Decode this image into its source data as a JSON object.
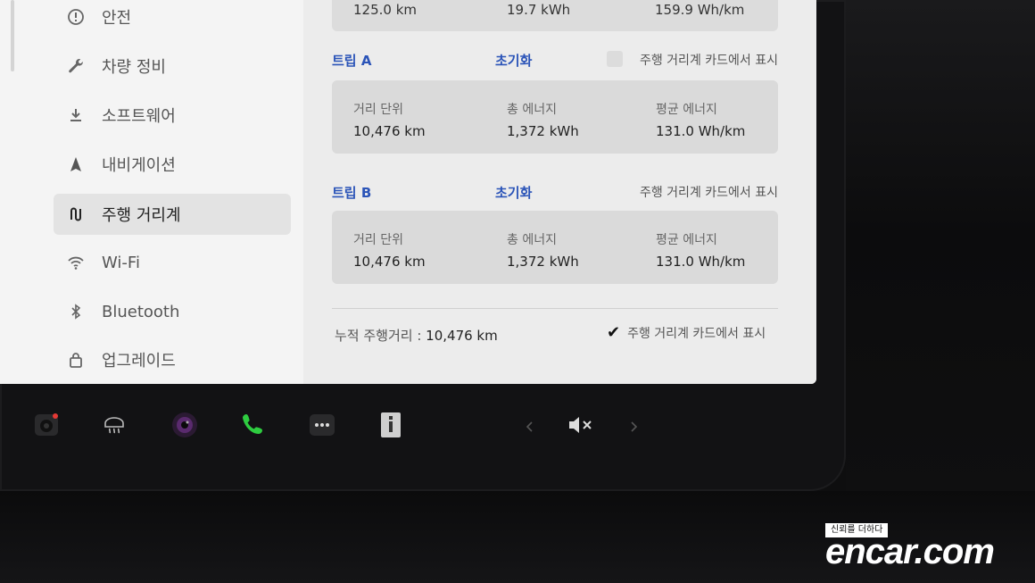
{
  "sidebar": {
    "items": [
      {
        "label": "안전",
        "icon": "shield-alert-icon"
      },
      {
        "label": "차량 정비",
        "icon": "wrench-icon"
      },
      {
        "label": "소프트웨어",
        "icon": "download-icon"
      },
      {
        "label": "내비게이션",
        "icon": "navigation-arrow-icon"
      },
      {
        "label": "주행 거리계",
        "icon": "trip-route-icon",
        "active": true
      },
      {
        "label": "Wi-Fi",
        "icon": "wifi-icon"
      },
      {
        "label": "Bluetooth",
        "icon": "bluetooth-icon"
      },
      {
        "label": "업그레이드",
        "icon": "shopping-bag-icon"
      }
    ]
  },
  "top_card": {
    "distance": "125.0 km",
    "energy": "19.7 kWh",
    "avg": "159.9 Wh/km"
  },
  "trip_a": {
    "name": "트립 A",
    "reset_label": "초기화",
    "show_label": "주행 거리계 카드에서 표시",
    "distance_label": "거리 단위",
    "distance_value": "10,476 km",
    "energy_label": "총 에너지",
    "energy_value": "1,372 kWh",
    "avg_label": "평균 에너지",
    "avg_value": "131.0 Wh/km"
  },
  "trip_b": {
    "name": "트립 B",
    "reset_label": "초기화",
    "show_label": "주행 거리계 카드에서 표시",
    "distance_label": "거리 단위",
    "distance_value": "10,476 km",
    "energy_label": "총 에너지",
    "energy_value": "1,372 kWh",
    "avg_label": "평균 에너지",
    "avg_value": "131.0 Wh/km"
  },
  "footer": {
    "total_label": "누적 주행거리 :",
    "total_value": "10,476 km",
    "show_label": "주행 거리계 카드에서 표시"
  },
  "taskbar": {
    "icons": [
      "camera-icon",
      "rear-defrost-icon",
      "media-icon",
      "phone-icon",
      "more-dots-icon",
      "manual-info-icon",
      "volume-mute-icon"
    ],
    "phone_color": "#2ecc40"
  },
  "watermark": {
    "tagline": "신뢰를 더하다",
    "brand": "encar.com"
  },
  "colors": {
    "accent": "#2b54b8",
    "screen_bg": "#ececec",
    "card_bg": "#dadada"
  }
}
